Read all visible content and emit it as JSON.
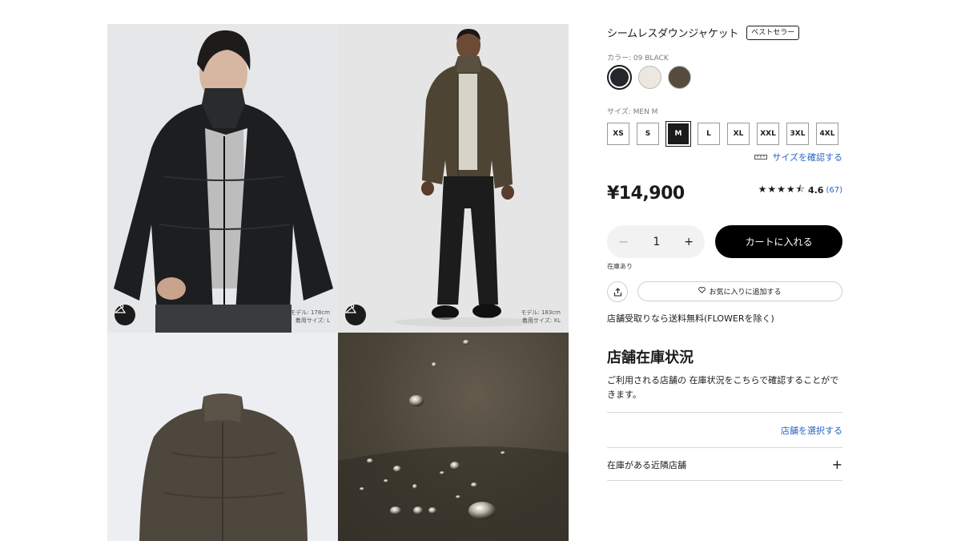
{
  "gallery": {
    "images": [
      {
        "alt": "black down jacket front model",
        "model_height": "モデル: 178cm",
        "model_size": "着用サイズ: L"
      },
      {
        "alt": "brown down jacket full body model",
        "model_height": "モデル: 183cm",
        "model_size": "着用サイズ: XL"
      },
      {
        "alt": "brown down jacket flat"
      },
      {
        "alt": "water droplets fabric close-up"
      }
    ]
  },
  "product": {
    "title": "シームレスダウンジャケット",
    "badge": "ベストセラー",
    "color_label": "カラー: 09 BLACK",
    "colors": [
      {
        "name": "09 BLACK",
        "hex": "#24272b",
        "selected": true
      },
      {
        "name": "OFF WHITE",
        "hex": "#ece8df",
        "selected": false
      },
      {
        "name": "BROWN",
        "hex": "#574b3d",
        "selected": false
      }
    ],
    "size_label": "サイズ: MEN M",
    "sizes": [
      "XS",
      "S",
      "M",
      "L",
      "XL",
      "XXL",
      "3XL",
      "4XL"
    ],
    "selected_size": "M",
    "size_guide": "サイズを確認する",
    "price": "¥14,900",
    "rating": {
      "stars": "★★★★⯪",
      "value": "4.6",
      "count": "(67)"
    },
    "quantity": "1",
    "add_to_cart": "カートに入れる",
    "stock": "在庫あり",
    "favorite": "お気に入りに追加する",
    "shipping": "店舗受取りなら送料無料(FLOWERを除く)"
  },
  "store": {
    "heading": "店舗在庫状況",
    "description": "ご利用される店舗の 在庫状況をこちらで確認することができます。",
    "select_store": "店舗を選択する",
    "nearby": "在庫がある近隣店舗"
  },
  "colors": {
    "link": "#2666c4",
    "primary": "#000000"
  }
}
